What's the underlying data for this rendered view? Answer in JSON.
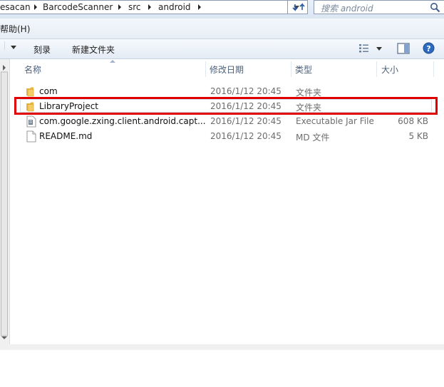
{
  "address_bar": {
    "crumbs": [
      "esacan",
      "BarcodeScanner",
      "src",
      "android"
    ]
  },
  "search": {
    "placeholder": "搜索 android"
  },
  "menu": {
    "items": [
      "帮助(H)"
    ]
  },
  "toolbar": {
    "burn_label": "刻录",
    "new_folder_label": "新建文件夹"
  },
  "columns": {
    "name": "名称",
    "date": "修改日期",
    "type": "类型",
    "size": "大小"
  },
  "files": [
    {
      "name": "com",
      "date": "2016/1/12 20:45",
      "type": "文件夹",
      "size": "",
      "icon": "folder-icon"
    },
    {
      "name": "LibraryProject",
      "date": "2016/1/12 20:45",
      "type": "文件夹",
      "size": "",
      "icon": "folder-icon"
    },
    {
      "name": "com.google.zxing.client.android.capt...",
      "date": "2016/1/12 20:45",
      "type": "Executable Jar File",
      "size": "608 KB",
      "icon": "jar-file-icon"
    },
    {
      "name": "README.md",
      "date": "2016/1/12 20:45",
      "type": "MD 文件",
      "size": "5 KB",
      "icon": "text-file-icon"
    }
  ],
  "colors": {
    "highlight": "#e00000",
    "folder": "#f2c14e",
    "help": "#2d6bbf"
  }
}
